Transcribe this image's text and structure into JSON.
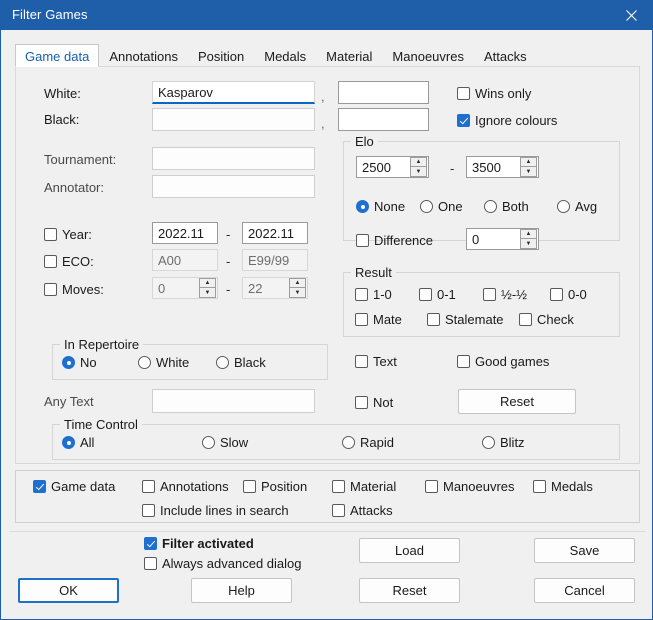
{
  "window": {
    "title": "Filter Games",
    "close_icon": "close-icon",
    "accent": "#1f5fa9",
    "checkbox_accent": "#1f6fd0"
  },
  "tabs": [
    {
      "label": "Game data",
      "active": true
    },
    {
      "label": "Annotations",
      "active": false
    },
    {
      "label": "Position",
      "active": false
    },
    {
      "label": "Medals",
      "active": false
    },
    {
      "label": "Material",
      "active": false
    },
    {
      "label": "Manoeuvres",
      "active": false
    },
    {
      "label": "Attacks",
      "active": false
    }
  ],
  "players": {
    "white_label": "White:",
    "white_value": "Kasparov",
    "white_second_value": "",
    "black_label": "Black:",
    "black_value": "",
    "black_second_value": "",
    "separator": ",",
    "wins_only": {
      "label": "Wins only",
      "checked": false
    },
    "ignore_colours": {
      "label": "Ignore colours",
      "checked": true
    }
  },
  "event": {
    "tournament_label": "Tournament:",
    "tournament_value": "",
    "annotator_label": "Annotator:",
    "annotator_value": ""
  },
  "elo": {
    "caption": "Elo",
    "min": "2500",
    "max": "3500",
    "range_separator": "-",
    "modes": [
      {
        "label": "None",
        "selected": true
      },
      {
        "label": "One",
        "selected": false
      },
      {
        "label": "Both",
        "selected": false
      },
      {
        "label": "Avg",
        "selected": false
      }
    ],
    "difference": {
      "label": "Difference",
      "checked": false,
      "value": "0"
    }
  },
  "ranges": {
    "year": {
      "label": "Year:",
      "checked": false,
      "from": "2022.11",
      "to": "2022.11",
      "enabled": true
    },
    "eco": {
      "label": "ECO:",
      "checked": false,
      "from": "A00",
      "to": "E99/99",
      "enabled": false
    },
    "moves": {
      "label": "Moves:",
      "checked": false,
      "from": "0",
      "to": "22",
      "enabled": false
    },
    "separator": "-"
  },
  "result": {
    "caption": "Result",
    "row1": [
      {
        "label": "1-0",
        "checked": false
      },
      {
        "label": "0-1",
        "checked": false
      },
      {
        "label": "½-½",
        "checked": false
      },
      {
        "label": "0-0",
        "checked": false
      }
    ],
    "row2": [
      {
        "label": "Mate",
        "checked": false
      },
      {
        "label": "Stalemate",
        "checked": false
      },
      {
        "label": "Check",
        "checked": false
      }
    ]
  },
  "repertoire": {
    "caption": "In Repertoire",
    "options": [
      {
        "label": "No",
        "selected": true
      },
      {
        "label": "White",
        "selected": false
      },
      {
        "label": "Black",
        "selected": false
      }
    ]
  },
  "any_text": {
    "label": "Any Text",
    "value": ""
  },
  "text_options": {
    "text": {
      "label": "Text",
      "checked": false
    },
    "good_games": {
      "label": "Good games",
      "checked": false
    },
    "not": {
      "label": "Not",
      "checked": false
    },
    "reset_label": "Reset"
  },
  "time_control": {
    "caption": "Time Control",
    "options": [
      {
        "label": "All",
        "selected": true
      },
      {
        "label": "Slow",
        "selected": false
      },
      {
        "label": "Rapid",
        "selected": false
      },
      {
        "label": "Blitz",
        "selected": false
      }
    ]
  },
  "search_scope": {
    "row1": [
      {
        "label": "Game data",
        "checked": true
      },
      {
        "label": "Annotations",
        "checked": false
      },
      {
        "label": "Position",
        "checked": false
      },
      {
        "label": "Material",
        "checked": false
      },
      {
        "label": "Manoeuvres",
        "checked": false
      },
      {
        "label": "Medals",
        "checked": false
      }
    ],
    "row2": [
      {
        "label": "Include lines in search",
        "checked": false
      },
      {
        "label": "Attacks",
        "checked": false
      }
    ]
  },
  "footer": {
    "filter_activated": {
      "label": "Filter activated",
      "checked": true
    },
    "always_advanced": {
      "label": "Always advanced dialog",
      "checked": false
    },
    "load_label": "Load",
    "save_label": "Save",
    "ok_label": "OK",
    "help_label": "Help",
    "reset_label": "Reset",
    "cancel_label": "Cancel"
  }
}
